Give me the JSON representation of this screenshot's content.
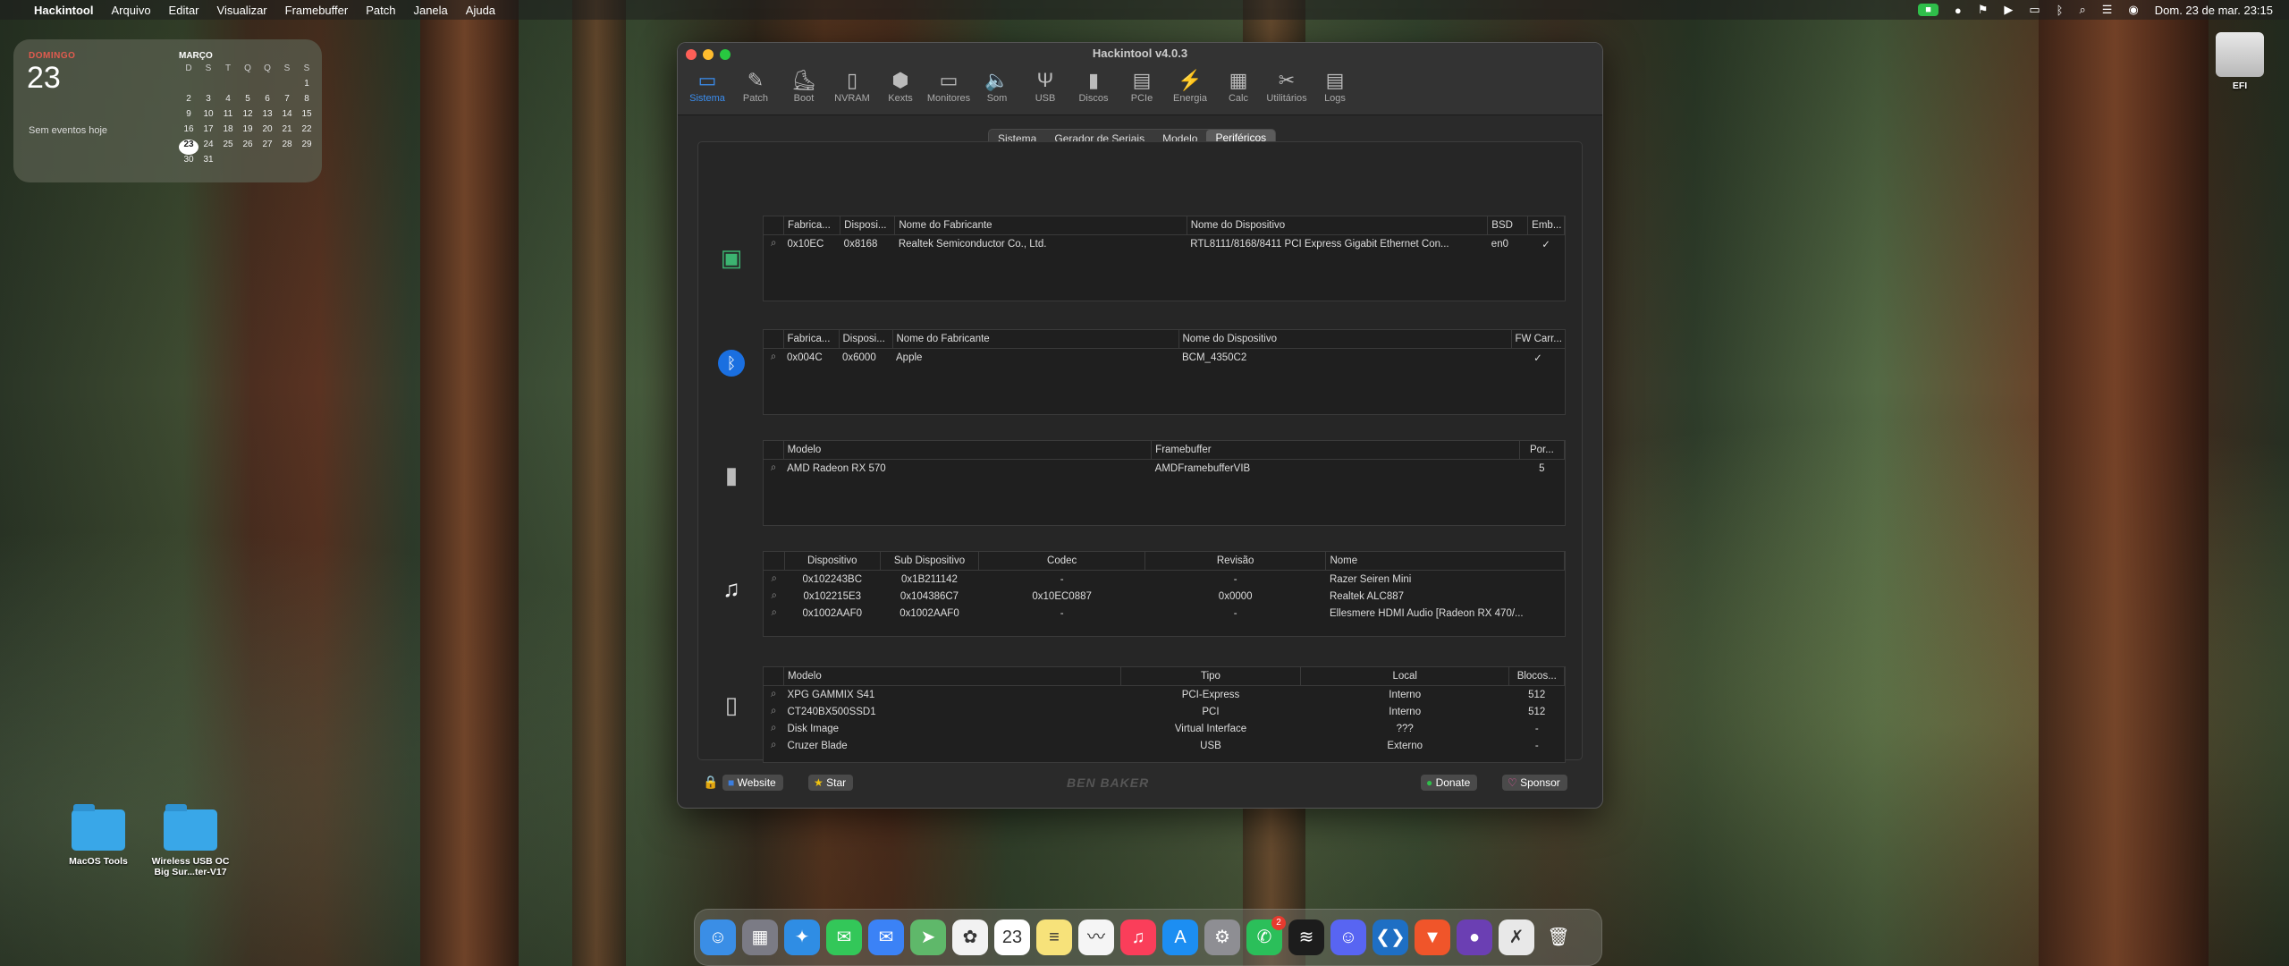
{
  "menubar": {
    "apple": "",
    "app": "Hackintool",
    "items": [
      "Arquivo",
      "Editar",
      "Visualizar",
      "Framebuffer",
      "Patch",
      "Janela",
      "Ajuda"
    ],
    "clock": "Dom. 23 de mar.  23:15"
  },
  "widget": {
    "weekday": "DOMINGO",
    "day": "23",
    "no_events": "Sem eventos hoje",
    "month": "MARÇO",
    "headers": [
      "D",
      "S",
      "T",
      "Q",
      "Q",
      "S",
      "S"
    ],
    "days": [
      "",
      "",
      "",
      "",
      "",
      "",
      "1",
      "2",
      "3",
      "4",
      "5",
      "6",
      "7",
      "8",
      "9",
      "10",
      "11",
      "12",
      "13",
      "14",
      "15",
      "16",
      "17",
      "18",
      "19",
      "20",
      "21",
      "22",
      "23",
      "24",
      "25",
      "26",
      "27",
      "28",
      "29",
      "30",
      "31"
    ],
    "today": "23"
  },
  "window": {
    "title": "Hackintool v4.0.3",
    "toolbar": [
      {
        "label": "Sistema",
        "icon": "system-icon",
        "glyph": "▭",
        "active": true
      },
      {
        "label": "Patch",
        "icon": "patch-icon",
        "glyph": "✎"
      },
      {
        "label": "Boot",
        "icon": "boot-icon",
        "glyph": "⛸"
      },
      {
        "label": "NVRAM",
        "icon": "nvram-icon",
        "glyph": "▯"
      },
      {
        "label": "Kexts",
        "icon": "kexts-icon",
        "glyph": "⬢"
      },
      {
        "label": "Monitores",
        "icon": "monitor-icon",
        "glyph": "▭"
      },
      {
        "label": "Som",
        "icon": "speaker-icon",
        "glyph": "🔈"
      },
      {
        "label": "USB",
        "icon": "usb-icon",
        "glyph": "Ψ"
      },
      {
        "label": "Discos",
        "icon": "disk-icon",
        "glyph": "▮"
      },
      {
        "label": "PCIe",
        "icon": "pcie-icon",
        "glyph": "▤"
      },
      {
        "label": "Energia",
        "icon": "energy-icon",
        "glyph": "⚡"
      },
      {
        "label": "Calc",
        "icon": "calculator-icon",
        "glyph": "▦"
      },
      {
        "label": "Utilitários",
        "icon": "utilities-icon",
        "glyph": "✂"
      },
      {
        "label": "Logs",
        "icon": "logs-icon",
        "glyph": "▤"
      }
    ],
    "tabs": [
      {
        "label": "Sistema"
      },
      {
        "label": "Gerador de Seriais"
      },
      {
        "label": "Modelo"
      },
      {
        "label": "Periféricos",
        "selected": true
      }
    ],
    "network": {
      "headers": [
        "Fabrica...",
        "Disposi...",
        "Nome do Fabricante",
        "Nome do Dispositivo",
        "BSD",
        "Emb..."
      ],
      "rows": [
        [
          "0x10EC",
          "0x8168",
          "Realtek Semiconductor Co., Ltd.",
          "RTL8111/8168/8411 PCI Express Gigabit Ethernet Con...",
          "en0",
          "✓"
        ]
      ]
    },
    "bluetooth": {
      "headers": [
        "Fabrica...",
        "Disposi...",
        "Nome do Fabricante",
        "Nome do Dispositivo",
        "FW Carr..."
      ],
      "rows": [
        [
          "0x004C",
          "0x6000",
          "Apple",
          "BCM_4350C2",
          "✓"
        ]
      ]
    },
    "graphics": {
      "headers": [
        "Modelo",
        "Framebuffer",
        "Por..."
      ],
      "rows": [
        [
          "AMD Radeon RX 570",
          "AMDFramebufferVIB",
          "5"
        ]
      ]
    },
    "audio": {
      "headers": [
        "Dispositivo",
        "Sub Dispositivo",
        "Codec",
        "Revisão",
        "Nome"
      ],
      "rows": [
        [
          "0x102243BC",
          "0x1B211142",
          "-",
          "-",
          "Razer Seiren Mini"
        ],
        [
          "0x102215E3",
          "0x104386C7",
          "0x10EC0887",
          "0x0000",
          "Realtek ALC887"
        ],
        [
          "0x1002AAF0",
          "0x1002AAF0",
          "-",
          "-",
          "Ellesmere HDMI Audio [Radeon RX 470/..."
        ]
      ]
    },
    "storage": {
      "headers": [
        "Modelo",
        "Tipo",
        "Local",
        "Blocos..."
      ],
      "rows": [
        [
          "XPG GAMMIX S41",
          "PCI-Express",
          "Interno",
          "512"
        ],
        [
          "CT240BX500SSD1",
          "PCI",
          "Interno",
          "512"
        ],
        [
          "Disk Image",
          "Virtual Interface",
          "???",
          "-"
        ],
        [
          "Cruzer Blade",
          "USB",
          "Externo",
          "-"
        ]
      ]
    },
    "footer": {
      "website": "Website",
      "star": "Star",
      "brand": "BEN BAKER",
      "donate": "Donate",
      "sponsor": "Sponsor"
    }
  },
  "desktop": {
    "icons": [
      {
        "name": "MacOS Tools"
      },
      {
        "name": "Wireless USB OC Big Sur...ter-V17"
      },
      {
        "name": "EFI"
      }
    ]
  },
  "dock": {
    "apps": [
      {
        "icon": "finder-icon",
        "bg": "#3a8ee6",
        "glyph": "☺"
      },
      {
        "icon": "launchpad-icon",
        "bg": "#7b7b85",
        "glyph": "▦"
      },
      {
        "icon": "safari-icon",
        "bg": "#2f8de4",
        "glyph": "✦"
      },
      {
        "icon": "messages-icon",
        "bg": "#33c759",
        "glyph": "✉"
      },
      {
        "icon": "mail-icon",
        "bg": "#3b82f6",
        "glyph": "✉"
      },
      {
        "icon": "maps-icon",
        "bg": "#5fb86a",
        "glyph": "➤"
      },
      {
        "icon": "photos-icon",
        "bg": "#f2f2f2",
        "glyph": "✿"
      },
      {
        "icon": "calendar-icon",
        "bg": "#ffffff",
        "glyph": "23"
      },
      {
        "icon": "notes-icon",
        "bg": "#f7e27a",
        "glyph": "≡"
      },
      {
        "icon": "freeform-icon",
        "bg": "#f5f5f5",
        "glyph": "〰"
      },
      {
        "icon": "music-icon",
        "bg": "#fa3e5a",
        "glyph": "♫"
      },
      {
        "icon": "app-store-icon",
        "bg": "#1c8ef2",
        "glyph": "A"
      },
      {
        "icon": "settings-icon",
        "bg": "#8e8e93",
        "glyph": "⚙"
      },
      {
        "icon": "whatsapp-icon",
        "bg": "#2bbf5a",
        "glyph": "✆",
        "badge": "2"
      },
      {
        "icon": "spotify-icon",
        "bg": "#1c1c1c",
        "glyph": "≋"
      },
      {
        "icon": "discord-icon",
        "bg": "#5865f2",
        "glyph": "☺"
      },
      {
        "icon": "vscode-icon",
        "bg": "#1e6fc4",
        "glyph": "❮❯"
      },
      {
        "icon": "brave-icon",
        "bg": "#f0552a",
        "glyph": "▼"
      },
      {
        "icon": "github-icon",
        "bg": "#6b3fb3",
        "glyph": "●"
      },
      {
        "icon": "hackintool-icon",
        "bg": "#e8e8e8",
        "glyph": "✗"
      },
      {
        "icon": "trash-icon",
        "bg": "transparent",
        "glyph": "🗑"
      }
    ]
  }
}
